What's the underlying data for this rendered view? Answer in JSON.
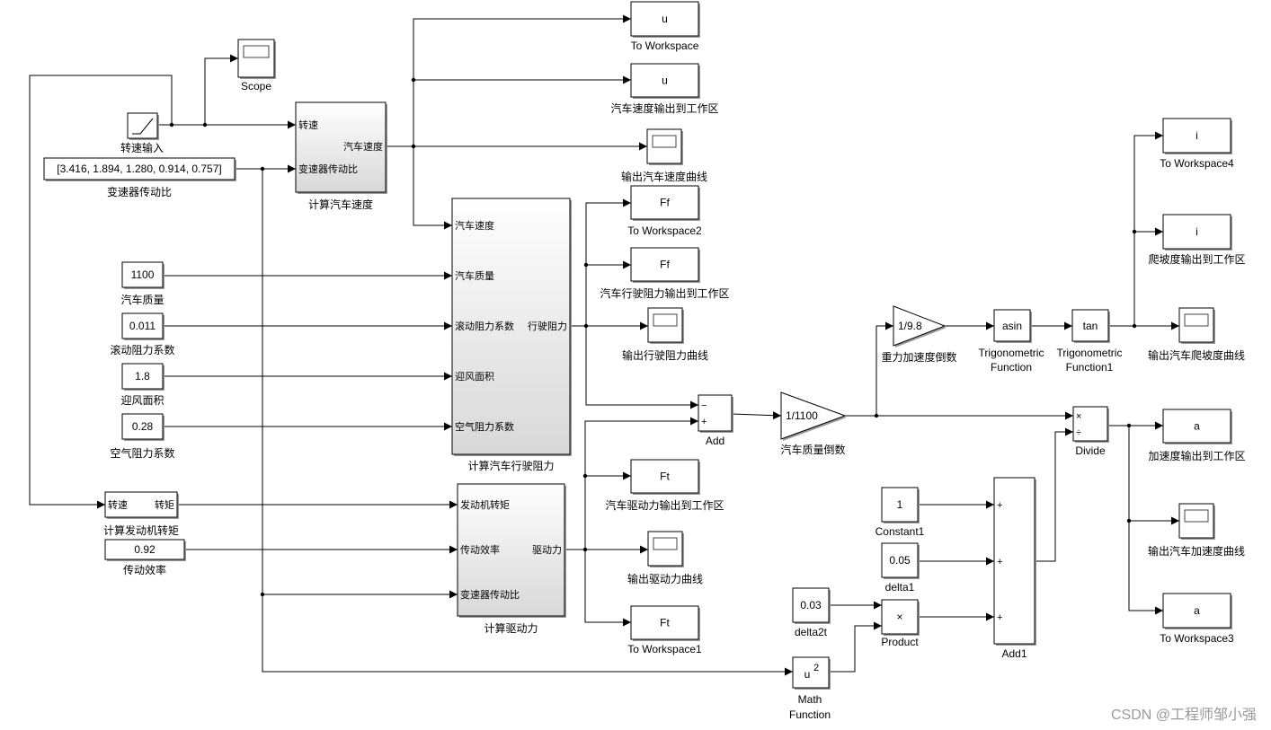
{
  "blocks": {
    "scope": {
      "label": "Scope"
    },
    "speed_input": {
      "label": "转速输入"
    },
    "gear_ratio": {
      "value": "[3.416, 1.894, 1.280, 0.914, 0.757]",
      "label": "变速器传动比"
    },
    "calc_speed": {
      "label": "计算汽车速度",
      "inputs": [
        "转速",
        "变速器传动比"
      ],
      "out": "汽车速度"
    },
    "tw_u": {
      "value": "u",
      "label": "To Workspace"
    },
    "speed_ws": {
      "value": "u",
      "label": "汽车速度输出到工作区"
    },
    "speed_scope": {
      "label": "输出汽车速度曲线"
    },
    "tw2": {
      "value": "Ff",
      "label": "To Workspace2"
    },
    "resist_ws": {
      "value": "Ff",
      "label": "汽车行驶阻力输出到工作区"
    },
    "resist_scope": {
      "label": "输出行驶阻力曲线"
    },
    "calc_resist": {
      "label": "计算汽车行驶阻力",
      "inputs": [
        "汽车速度",
        "汽车质量",
        "滚动阻力系数",
        "迎风面积",
        "空气阻力系数"
      ],
      "out": "行驶阻力"
    },
    "mass": {
      "value": "1100",
      "label": "汽车质量"
    },
    "roll": {
      "value": "0.011",
      "label": "滚动阻力系数"
    },
    "area": {
      "value": "1.8",
      "label": "迎风面积"
    },
    "air": {
      "value": "0.28",
      "label": "空气阻力系数"
    },
    "engine_torque": {
      "label": "计算发动机转矩",
      "inputs": [
        "转速"
      ],
      "out": "转矩"
    },
    "efficiency": {
      "value": "0.92",
      "label": "传动效率"
    },
    "calc_drive": {
      "label": "计算驱动力",
      "inputs": [
        "发动机转矩",
        "传动效率",
        "变速器传动比"
      ],
      "out": "驱动力"
    },
    "drive_ws": {
      "value": "Ft",
      "label": "汽车驱动力输出到工作区"
    },
    "drive_scope": {
      "label": "输出驱动力曲线"
    },
    "tw1": {
      "value": "Ft",
      "label": "To Workspace1"
    },
    "add": {
      "label": "Add",
      "inputs": [
        "−",
        "+"
      ]
    },
    "inv_mass": {
      "value": "1/1100",
      "label": "汽车质量倒数"
    },
    "inv_g": {
      "value": "1/9.8",
      "label": "重力加速度倒数"
    },
    "asin": {
      "value": "asin",
      "label": [
        "Trigonometric",
        "Function"
      ]
    },
    "tan": {
      "value": "tan",
      "label": [
        "Trigonometric",
        "Function1"
      ]
    },
    "tw4": {
      "value": "i",
      "label": "To Workspace4"
    },
    "grade_ws": {
      "value": "i",
      "label": "爬坡度输出到工作区"
    },
    "grade_scope": {
      "label": "输出汽车爬坡度曲线"
    },
    "divide": {
      "label": "Divide",
      "inputs": [
        "×",
        "÷"
      ]
    },
    "accel_ws": {
      "value": "a",
      "label": "加速度输出到工作区"
    },
    "accel_scope": {
      "label": "输出汽车加速度曲线"
    },
    "tw3": {
      "value": "a",
      "label": "To Workspace3"
    },
    "constant1": {
      "value": "1",
      "label": "Constant1"
    },
    "delta1": {
      "value": "0.05",
      "label": "delta1"
    },
    "delta2t": {
      "value": "0.03",
      "label": "delta2t"
    },
    "product": {
      "value": "×",
      "label": "Product"
    },
    "add1": {
      "label": "Add1",
      "inputs": [
        "+",
        "+",
        "+"
      ]
    },
    "math": {
      "value": "u",
      "exponent": "2",
      "label": [
        "Math",
        "Function"
      ]
    }
  },
  "watermark": "CSDN @工程师邹小强"
}
